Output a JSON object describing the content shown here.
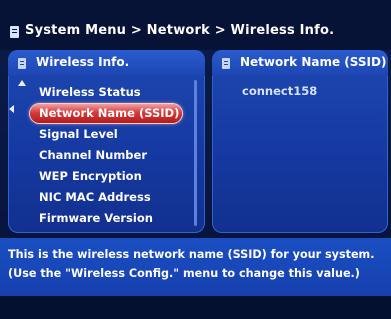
{
  "breadcrumb": "System Menu > Network > Wireless Info.",
  "left_panel": {
    "title": "Wireless Info.",
    "items": [
      {
        "label": "Wireless Status"
      },
      {
        "label": "Network Name (SSID)",
        "selected": true
      },
      {
        "label": "Signal Level"
      },
      {
        "label": "Channel Number"
      },
      {
        "label": "WEP Encryption"
      },
      {
        "label": "NIC MAC Address"
      },
      {
        "label": "Firmware Version"
      }
    ]
  },
  "right_panel": {
    "title": "Network Name (SSID)",
    "value": "connect158"
  },
  "help": {
    "line1": "This is the wireless network name (SSID) for your system.",
    "line2": "(Use the \"Wireless Config.\" menu to change this value.)"
  },
  "colors": {
    "selection": "#d63a3a",
    "panel": "#1c48b0",
    "background": "#06123a"
  }
}
